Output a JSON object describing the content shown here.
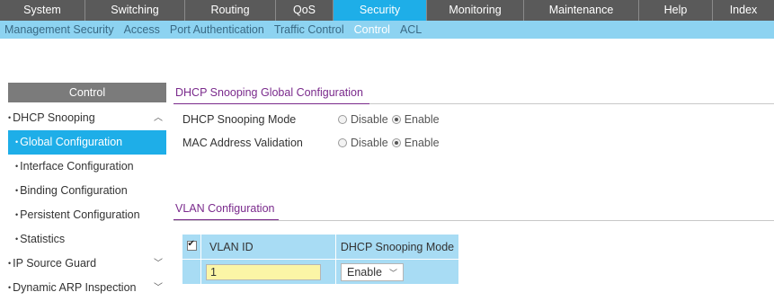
{
  "top_nav": {
    "tabs": [
      {
        "label": "System"
      },
      {
        "label": "Switching"
      },
      {
        "label": "Routing"
      },
      {
        "label": "QoS"
      },
      {
        "label": "Security",
        "active": true
      },
      {
        "label": "Monitoring"
      },
      {
        "label": "Maintenance"
      },
      {
        "label": "Help"
      },
      {
        "label": "Index"
      }
    ]
  },
  "sub_nav": {
    "items": [
      {
        "label": "Management Security"
      },
      {
        "label": "Access"
      },
      {
        "label": "Port Authentication"
      },
      {
        "label": "Traffic Control"
      },
      {
        "label": "Control",
        "active": true
      },
      {
        "label": "ACL"
      }
    ]
  },
  "sidebar": {
    "header": "Control",
    "items": [
      {
        "label": "DHCP Snooping",
        "level": 1,
        "chevron": "up"
      },
      {
        "label": "Global Configuration",
        "level": 2,
        "active": true
      },
      {
        "label": "Interface Configuration",
        "level": 2
      },
      {
        "label": "Binding Configuration",
        "level": 2
      },
      {
        "label": "Persistent Configuration",
        "level": 2
      },
      {
        "label": "Statistics",
        "level": 2
      },
      {
        "label": "IP Source Guard",
        "level": 1,
        "chevron": "down"
      },
      {
        "label": "Dynamic ARP Inspection",
        "level": 1,
        "chevron": "down"
      }
    ]
  },
  "global_config": {
    "title": "DHCP Snooping Global Configuration",
    "rows": [
      {
        "label": "DHCP Snooping Mode",
        "options": [
          "Disable",
          "Enable"
        ],
        "selected": "Enable"
      },
      {
        "label": "MAC Address Validation",
        "options": [
          "Disable",
          "Enable"
        ],
        "selected": "Enable"
      }
    ]
  },
  "vlan_config": {
    "title": "VLAN Configuration",
    "table": {
      "headers": [
        "VLAN ID",
        "DHCP Snooping Mode"
      ],
      "header_checked": true,
      "row": {
        "vlan_id": "1",
        "mode": "Enable"
      }
    }
  },
  "colors": {
    "nav_bg": "#5a5a5a",
    "accent": "#1eaee8",
    "subnav_bg": "#8dd3f1",
    "section_title": "#7a2a8c",
    "table_bg": "#a8dcf4",
    "input_bg": "#fbf5a6"
  }
}
